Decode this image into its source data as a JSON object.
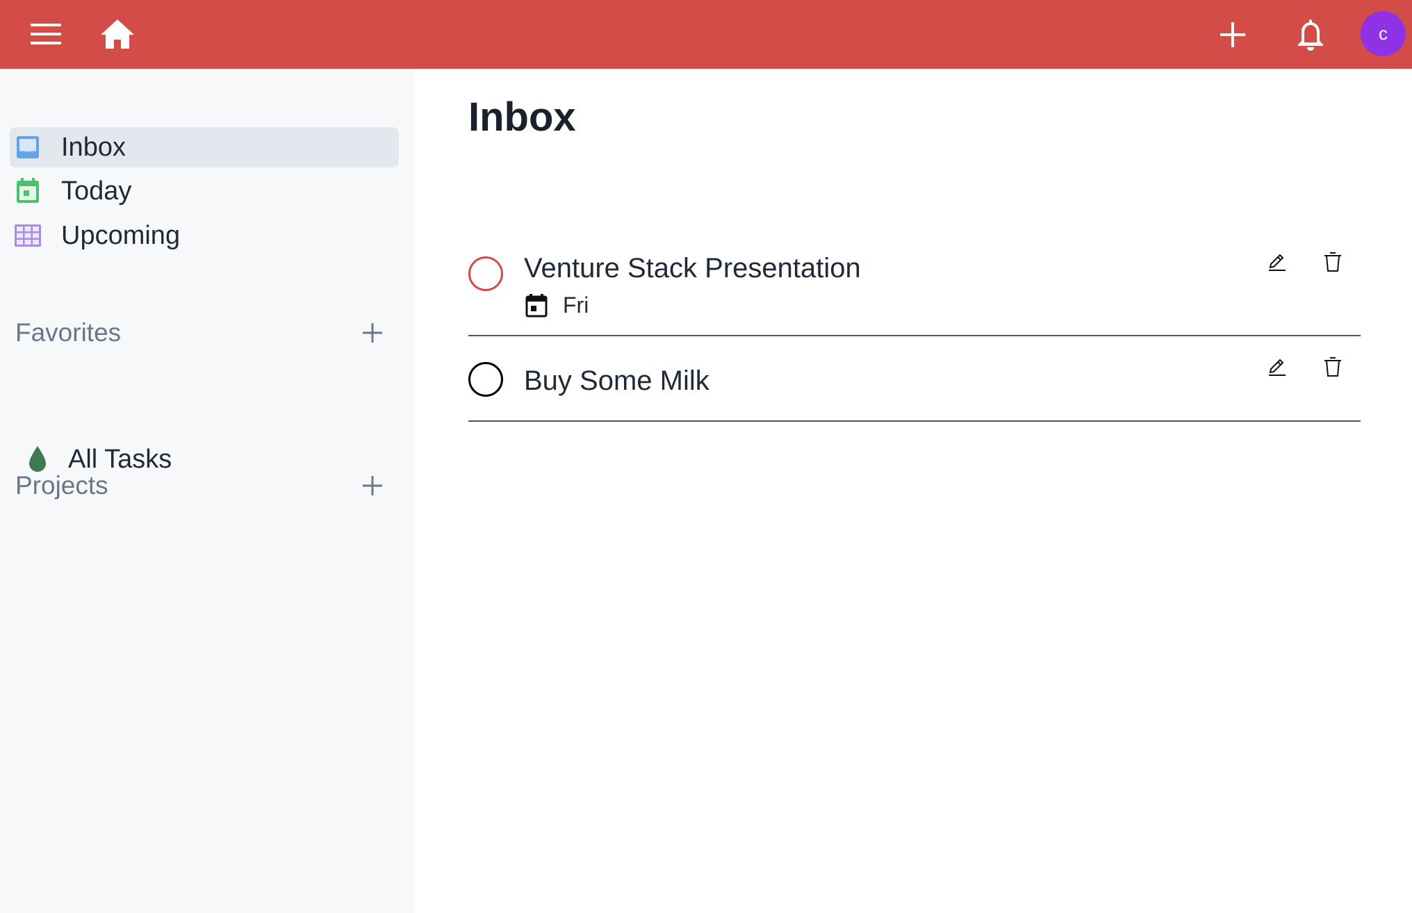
{
  "header": {
    "menu_icon": "hamburger-menu-icon",
    "home_icon": "home-icon",
    "add_icon": "plus-icon",
    "notifications_icon": "bell-icon",
    "avatar_initial": "c",
    "bar_color": "#d44c47",
    "avatar_color": "#8f31e5"
  },
  "sidebar": {
    "nav": [
      {
        "label": "Inbox",
        "icon": "inbox-icon",
        "icon_color": "#63a4e6",
        "active": true
      },
      {
        "label": "Today",
        "icon": "calendar-today-icon",
        "icon_color": "#4cc06e"
      },
      {
        "label": "Upcoming",
        "icon": "calendar-grid-icon",
        "icon_color": "#a58ee3"
      }
    ],
    "favorites": {
      "title": "Favorites",
      "items": [
        {
          "label": "All Tasks",
          "icon": "droplet-icon",
          "icon_color": "#3e7a4f"
        }
      ]
    },
    "projects": {
      "title": "Projects"
    }
  },
  "main": {
    "title": "Inbox",
    "tasks": [
      {
        "title": "Venture Stack Presentation",
        "due": "Fri",
        "check_color": "#d44c47"
      },
      {
        "title": "Buy Some Milk",
        "check_color": "#000000"
      }
    ]
  }
}
